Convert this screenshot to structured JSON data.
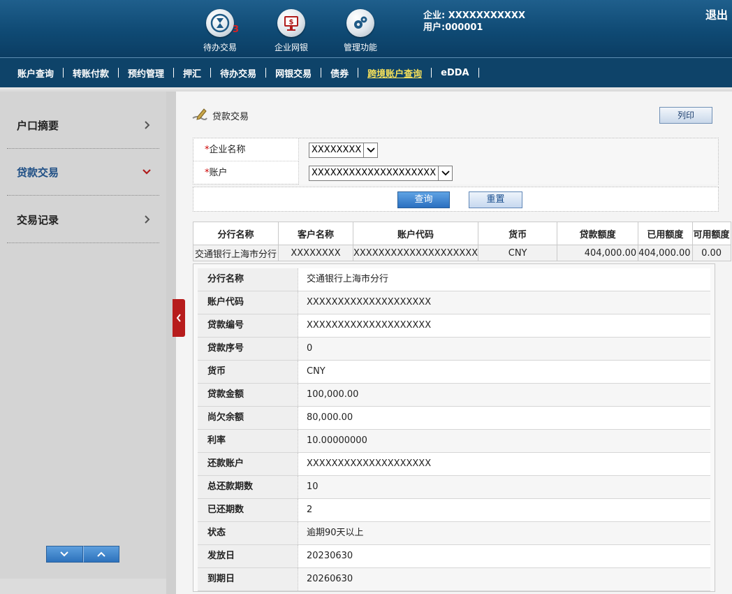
{
  "header": {
    "icons": [
      {
        "label": "待办交易",
        "icon": "pending-hourglass-icon",
        "badge": "3"
      },
      {
        "label": "企业网银",
        "icon": "monitor-dollar-icon"
      },
      {
        "label": "管理功能",
        "icon": "gears-icon"
      }
    ],
    "company_line": "企业: XXXXXXXXXXX",
    "user_line": "用户:000001",
    "logout": "退出"
  },
  "nav": {
    "items": [
      "账户查询",
      "转账付款",
      "预约管理",
      "押汇",
      "待办交易",
      "网银交易",
      "债券",
      "跨境账户查询",
      "eDDA"
    ],
    "active_index": 7
  },
  "sidebar": {
    "items": [
      {
        "label": "户口摘要",
        "icon": "chevron-right-icon"
      },
      {
        "label": "贷款交易",
        "icon": "chevron-down-icon",
        "active": true
      },
      {
        "label": "交易记录",
        "icon": "chevron-right-icon"
      }
    ]
  },
  "main": {
    "title": "贷款交易",
    "print_label": "列印",
    "form": {
      "company_label": "企业名称",
      "company_value": "XXXXXXXX",
      "account_label": "账户",
      "account_value": "XXXXXXXXXXXXXXXXXXXX",
      "required_mark": "*"
    },
    "query_label": "查询",
    "reset_label": "重置",
    "summary": {
      "headers": [
        "分行名称",
        "客户名称",
        "账户代码",
        "货币",
        "贷款额度",
        "已用额度",
        "可用额度"
      ],
      "row": [
        "交通银行上海市分行",
        "XXXXXXXX",
        "XXXXXXXXXXXXXXXXXXXX",
        "CNY",
        "404,000.00",
        "404,000.00",
        "0.00"
      ]
    },
    "detail": [
      {
        "k": "分行名称",
        "v": "交通银行上海市分行"
      },
      {
        "k": "账户代码",
        "v": "XXXXXXXXXXXXXXXXXXXX"
      },
      {
        "k": "贷款编号",
        "v": "XXXXXXXXXXXXXXXXXXXX"
      },
      {
        "k": "贷款序号",
        "v": "0"
      },
      {
        "k": "货币",
        "v": "CNY"
      },
      {
        "k": "贷款金额",
        "v": "100,000.00"
      },
      {
        "k": "尚欠余额",
        "v": "80,000.00"
      },
      {
        "k": "利率",
        "v": "10.00000000"
      },
      {
        "k": "还款账户",
        "v": "XXXXXXXXXXXXXXXXXXXX"
      },
      {
        "k": "总还款期数",
        "v": "10"
      },
      {
        "k": "已还期数",
        "v": "2"
      },
      {
        "k": "状态",
        "v": "逾期90天以上"
      },
      {
        "k": "发放日",
        "v": "20230630"
      },
      {
        "k": "到期日",
        "v": "20260630"
      }
    ]
  }
}
